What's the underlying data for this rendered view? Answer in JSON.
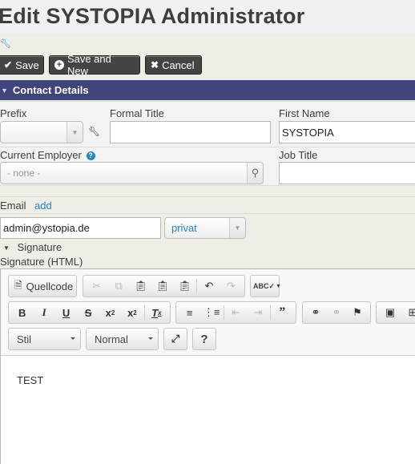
{
  "page": {
    "title": "Edit SYSTOPIA Administrator"
  },
  "actions": {
    "save": "Save",
    "save_and_new": "Save and New",
    "cancel": "Cancel"
  },
  "section": {
    "title": "Contact Details"
  },
  "fields": {
    "prefix": {
      "label": "Prefix",
      "value": ""
    },
    "formal_title": {
      "label": "Formal Title",
      "value": ""
    },
    "first_name": {
      "label": "First Name",
      "value": "SYSTOPIA"
    },
    "current_employer": {
      "label": "Current Employer",
      "placeholder": "- none -"
    },
    "job_title": {
      "label": "Job Title",
      "value": ""
    }
  },
  "email": {
    "label": "Email",
    "add_link": "add",
    "value": "admin@ystopia.de",
    "location_type": "privat"
  },
  "signature": {
    "toggle_label": "Signature",
    "html_label": "Signature (HTML)"
  },
  "editor": {
    "source_button": "Quellcode",
    "style_combo": "Stil",
    "format_combo": "Normal",
    "help_button": "?",
    "content": "TEST"
  }
}
